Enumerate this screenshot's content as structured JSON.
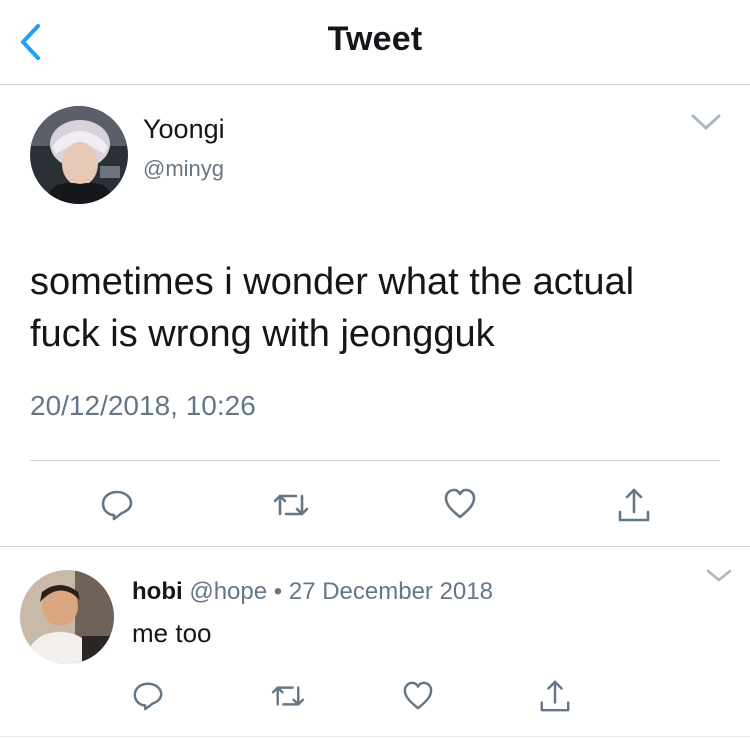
{
  "header": {
    "title": "Tweet",
    "back_icon": "chevron-left-icon"
  },
  "colors": {
    "accent": "#1da1f2",
    "text": "#14171a",
    "secondary": "#657786",
    "divider": "#cfd4d9"
  },
  "tweet": {
    "author": {
      "name": "Yoongi",
      "handle": "@minyg"
    },
    "text_lines": [
      "sometimes i wonder what the actual",
      "fuck is wrong with jeongguk"
    ],
    "timestamp": "20/12/2018, 10:26",
    "actions": [
      "reply-icon",
      "retweet-icon",
      "like-icon",
      "share-icon"
    ]
  },
  "reply": {
    "author": {
      "name": "hobi",
      "handle": "@hope"
    },
    "separator": "•",
    "date": "27 December 2018",
    "text": "me too",
    "actions": [
      "reply-icon",
      "retweet-icon",
      "like-icon",
      "share-icon"
    ]
  }
}
